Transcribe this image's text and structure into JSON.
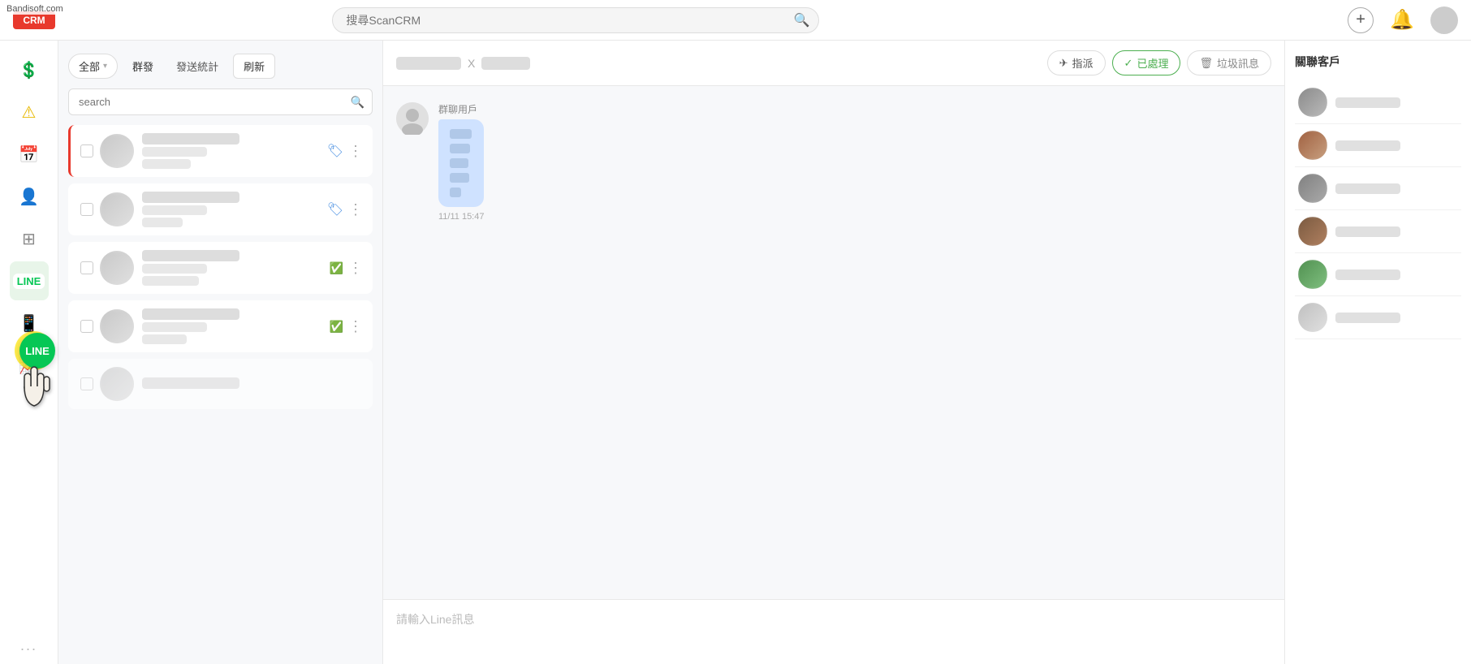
{
  "app": {
    "name": "CRM",
    "watermark": "Bandisoft.com"
  },
  "topbar": {
    "logo_label": "CRM",
    "search_placeholder": "搜尋ScanCRM",
    "add_btn_label": "+",
    "bell_icon": "🔔",
    "avatar_label": ""
  },
  "sidebar": {
    "items": [
      {
        "id": "dollar",
        "icon": "💲",
        "label": "財務",
        "active": false
      },
      {
        "id": "alert",
        "icon": "⚠",
        "label": "通知",
        "active": false,
        "badge": "!"
      },
      {
        "id": "calendar",
        "icon": "📅",
        "label": "行程",
        "active": false
      },
      {
        "id": "contacts",
        "icon": "👤",
        "label": "聯絡人",
        "active": false
      },
      {
        "id": "table",
        "icon": "📊",
        "label": "報表",
        "active": false
      },
      {
        "id": "line",
        "icon": "LINE",
        "label": "LINE",
        "active": true
      },
      {
        "id": "phone",
        "icon": "📱",
        "label": "電話",
        "active": false
      },
      {
        "id": "chart",
        "icon": "📈",
        "label": "圖表",
        "active": false
      }
    ],
    "more_label": "..."
  },
  "conv_panel": {
    "filter_label": "全部",
    "group_label": "群發",
    "stats_label": "發送統計",
    "refresh_label": "刷新",
    "search_placeholder": "search",
    "items": [
      {
        "id": 1,
        "name": "blurred_user_1",
        "msg": "blurred_msg_1",
        "tag": "label",
        "active": true
      },
      {
        "id": 2,
        "name": "blurred_user_2",
        "msg": "blurred_msg_2",
        "tag": "label"
      },
      {
        "id": 3,
        "name": "blurred_user_3",
        "msg": "blurred_msg_3",
        "tag": "processed"
      },
      {
        "id": 4,
        "name": "blurred_user_4",
        "msg": "blurred_msg_4",
        "tag": "processed"
      },
      {
        "id": 5,
        "name": "blurred_user_5",
        "msg": "blurred_msg_5",
        "tag": "none"
      }
    ]
  },
  "chat": {
    "title_part1": "blurred_title",
    "separator": "X",
    "title_part2": "blurred_sub",
    "actions": {
      "assign_label": "指派",
      "processed_label": "已處理",
      "trash_label": "垃圾訊息"
    },
    "messages": [
      {
        "sender": "群聊用戶",
        "time": "11/11 15:47",
        "bubble_lines": [
          4,
          3,
          2
        ]
      }
    ],
    "input_placeholder": "請輸入Line訊息"
  },
  "right_panel": {
    "title": "關聯客戶",
    "customers": [
      {
        "id": 1
      },
      {
        "id": 2
      },
      {
        "id": 3
      },
      {
        "id": 4
      },
      {
        "id": 5
      },
      {
        "id": 6
      }
    ]
  }
}
